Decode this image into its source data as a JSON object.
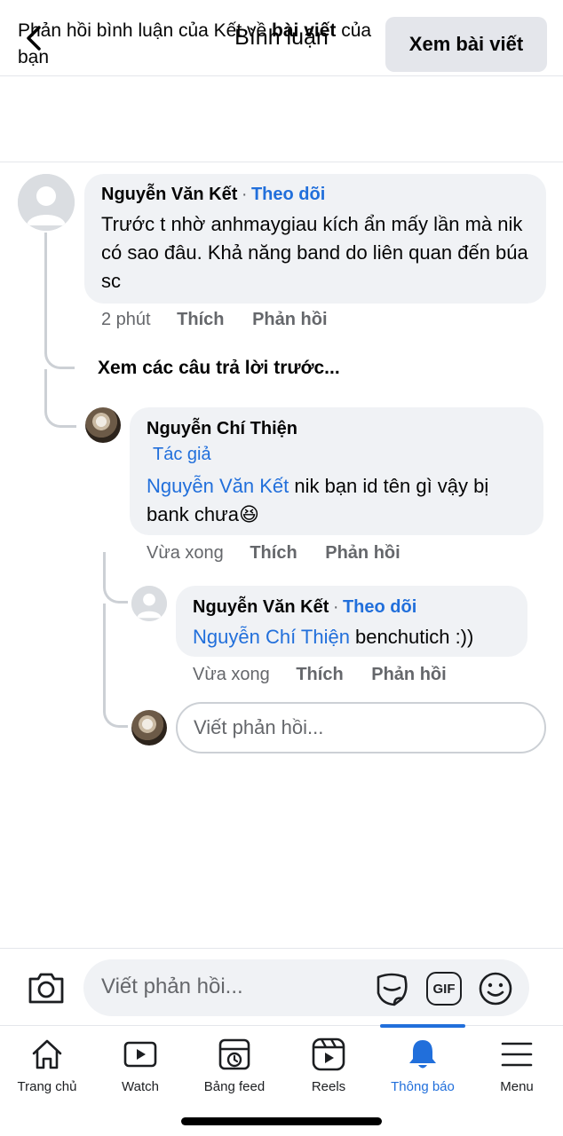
{
  "header": {
    "title": "Bình luận"
  },
  "context": {
    "text_prefix": "Phản hồi bình luận của Kết về ",
    "text_bold": "bài viết",
    "text_suffix": " của bạn",
    "view_post_label": "Xem bài viết"
  },
  "comment1": {
    "name": "Nguyễn Văn Kết",
    "separator": "·",
    "follow": "Theo dõi",
    "text": "Trước t nhờ anhmaygiau kích ẩn mấy lần mà nik có sao đâu. Khả năng band do liên quan đến búa sc",
    "time": "2 phút",
    "like": "Thích",
    "reply": "Phản hồi"
  },
  "view_previous": "Xem các câu trả lời trước...",
  "reply1": {
    "name": "Nguyễn Chí Thiện",
    "author_tag": "Tác giả",
    "mention": "Nguyễn Văn Kết",
    "text": " nik bạn id tên gì vậy bị bank chưa",
    "emoji": "😆",
    "time": "Vừa xong",
    "like": "Thích",
    "reply": "Phản hồi"
  },
  "reply2": {
    "name": "Nguyễn Văn Kết",
    "separator": "·",
    "follow": "Theo dõi",
    "mention": "Nguyễn Chí Thiện",
    "text": " benchutich :))",
    "time": "Vừa xong",
    "like": "Thích",
    "reply": "Phản hồi"
  },
  "inline_reply": {
    "placeholder": "Viết phản hồi..."
  },
  "composer": {
    "placeholder": "Viết phản hồi...",
    "gif_label": "GIF"
  },
  "tabs": [
    {
      "label": "Trang chủ",
      "icon": "home-icon"
    },
    {
      "label": "Watch",
      "icon": "video-icon"
    },
    {
      "label": "Bảng feed",
      "icon": "feed-icon"
    },
    {
      "label": "Reels",
      "icon": "reels-icon"
    },
    {
      "label": "Thông báo",
      "icon": "bell-icon",
      "active": true
    },
    {
      "label": "Menu",
      "icon": "menu-icon"
    }
  ],
  "colors": {
    "accent": "#216fdb",
    "bubble": "#f0f2f5",
    "muted": "#65676b"
  }
}
